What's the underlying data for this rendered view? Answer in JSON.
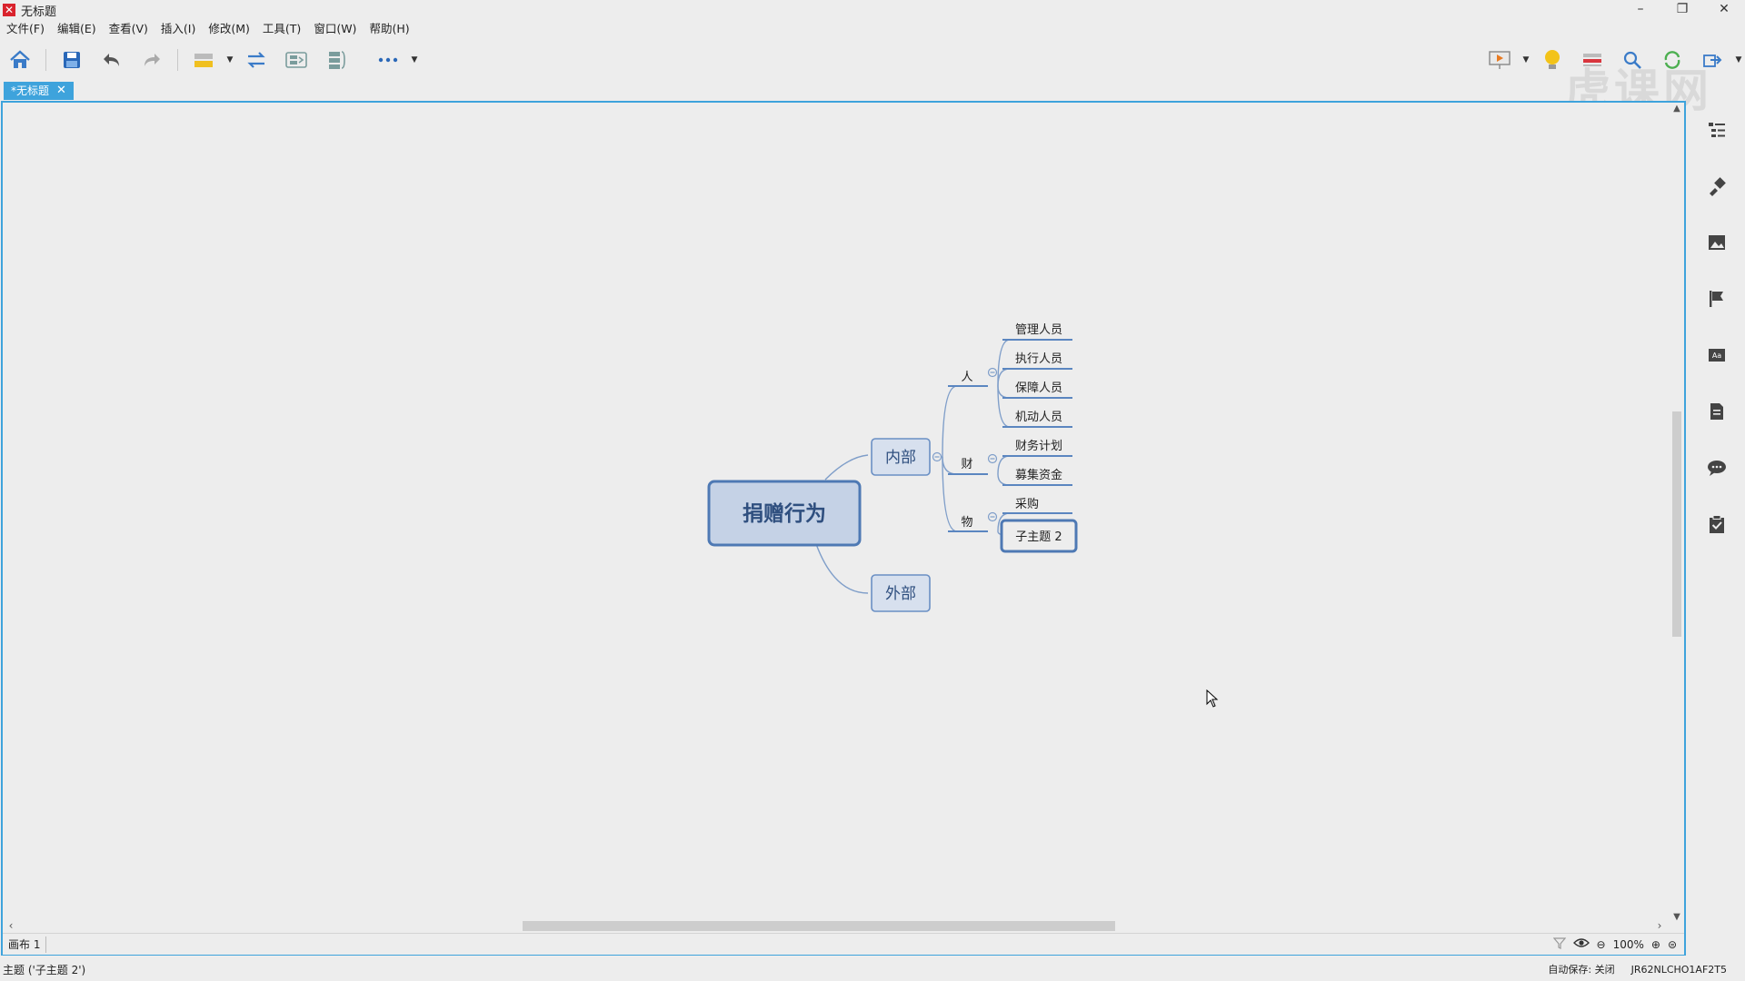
{
  "window": {
    "title": "无标题",
    "app_icon": "xmind-icon",
    "controls": [
      "minimize-icon",
      "restore-icon",
      "close-icon"
    ]
  },
  "menu": {
    "items": [
      "文件(F)",
      "编辑(E)",
      "查看(V)",
      "插入(I)",
      "修改(M)",
      "工具(T)",
      "窗口(W)",
      "帮助(H)"
    ]
  },
  "toolbar": {
    "icons": [
      "home-icon",
      "save-icon",
      "undo-icon",
      "redo-icon",
      "topic-icon",
      "relationship-icon",
      "summary-icon",
      "boundary-icon",
      "more-icon"
    ],
    "right_icons": [
      "presentation-icon",
      "idea-icon",
      "outline-view-icon",
      "search-icon",
      "share-icon",
      "export-icon"
    ]
  },
  "watermark": "虎课网",
  "tab": {
    "label": "*无标题"
  },
  "mindmap": {
    "central": "捐赠行为",
    "branches": {
      "internal": "内部",
      "external": "外部"
    },
    "sub": {
      "people": "人",
      "money": "财",
      "goods": "物"
    },
    "leaves": {
      "people": [
        "管理人员",
        "执行人员",
        "保障人员",
        "机动人员"
      ],
      "money": [
        "财务计划",
        "募集资金"
      ],
      "goods": [
        "采购",
        "子主题 2"
      ]
    },
    "selected": "子主题 2",
    "colors": {
      "central_fill": "#c5d2e6",
      "central_border": "#4e79b4",
      "branch_fill": "#d7e0ee",
      "line": "#7f9ec9",
      "accent": "#3ea3dc"
    }
  },
  "footer": {
    "sheet": "画布 1",
    "zoom": "100%"
  },
  "right_rail": {
    "icons": [
      "outline-icon",
      "format-brush-icon",
      "image-icon",
      "marker-flag-icon",
      "text-style-icon",
      "notes-icon",
      "comment-icon",
      "task-icon"
    ]
  },
  "status": {
    "selection": "主题 ('子主题 2')",
    "autosave": "自动保存: 关闭",
    "account": "JR62NLCHO1AF2T5"
  }
}
